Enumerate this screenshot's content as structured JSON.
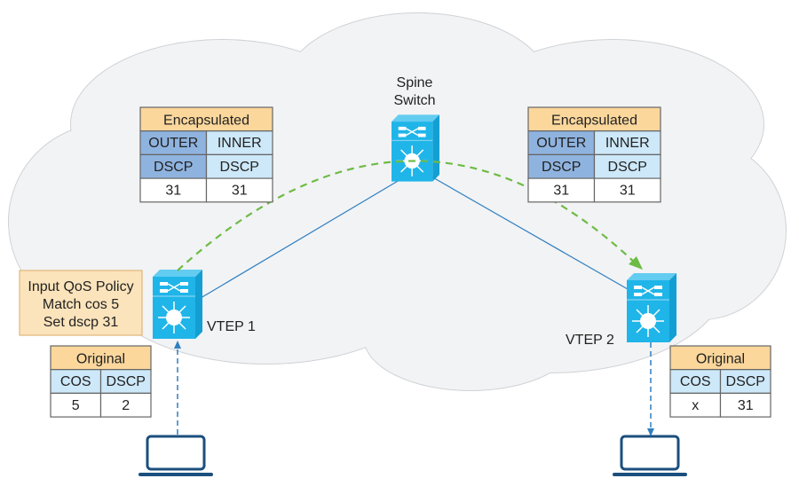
{
  "spine": {
    "line1": "Spine",
    "line2": "Switch"
  },
  "vtep1": {
    "label": "VTEP 1"
  },
  "vtep2": {
    "label": "VTEP 2"
  },
  "policy": {
    "lines": [
      "Input QoS Policy",
      "Match cos 5",
      "Set dscp 31"
    ]
  },
  "encap_left": {
    "title": "Encapsulated",
    "col1": [
      "OUTER",
      "DSCP",
      "31"
    ],
    "col2": [
      "INNER",
      "DSCP",
      "31"
    ]
  },
  "encap_right": {
    "title": "Encapsulated",
    "col1": [
      "OUTER",
      "DSCP",
      "31"
    ],
    "col2": [
      "INNER",
      "DSCP",
      "31"
    ]
  },
  "orig_left": {
    "title": "Original",
    "col1": [
      "COS",
      "5"
    ],
    "col2": [
      "DSCP",
      "2"
    ]
  },
  "orig_right": {
    "title": "Original",
    "col1": [
      "COS",
      "x"
    ],
    "col2": [
      "DSCP",
      "31"
    ]
  },
  "colors": {
    "switch": "#1fb5e9",
    "header": "#fbd79c",
    "outer": "#8fb3df",
    "inner": "#cde8f8",
    "green_path": "#6dbb45",
    "link": "#2f7fc0",
    "laptop": "#1b4f7e"
  }
}
